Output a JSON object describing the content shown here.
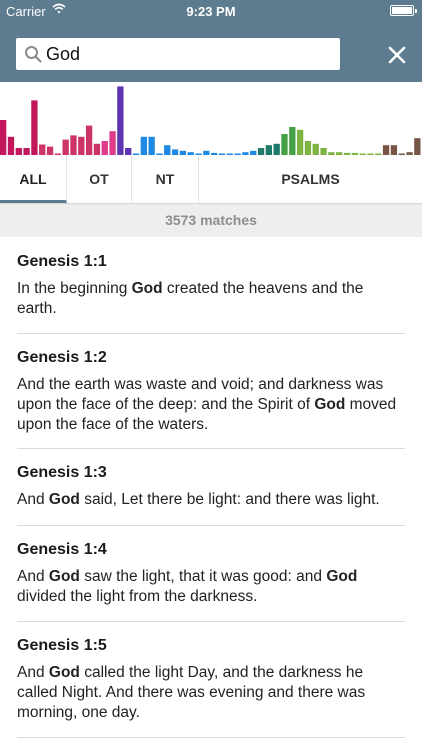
{
  "status": {
    "carrier": "Carrier",
    "time": "9:23 PM"
  },
  "search": {
    "query": "God",
    "placeholder": ""
  },
  "histogram": {
    "colors": {
      "law": "#c2185b",
      "history": "#cc3366",
      "poetry": "#e03b8a",
      "major_prophets": "#5e35b1",
      "minor_prophets": "#1e88e5",
      "gospels": "#1e7a6a",
      "acts": "#43a047",
      "epistles": "#7cb342",
      "revelation": "#795548"
    },
    "bars": [
      {
        "value": 0.5,
        "color": "law"
      },
      {
        "value": 0.26,
        "color": "law"
      },
      {
        "value": 0.1,
        "color": "law"
      },
      {
        "value": 0.1,
        "color": "law"
      },
      {
        "value": 0.78,
        "color": "law"
      },
      {
        "value": 0.15,
        "color": "history"
      },
      {
        "value": 0.12,
        "color": "history"
      },
      {
        "value": 0.02,
        "color": "history"
      },
      {
        "value": 0.22,
        "color": "history"
      },
      {
        "value": 0.28,
        "color": "history"
      },
      {
        "value": 0.26,
        "color": "history"
      },
      {
        "value": 0.42,
        "color": "history"
      },
      {
        "value": 0.16,
        "color": "history"
      },
      {
        "value": 0.2,
        "color": "poetry"
      },
      {
        "value": 0.34,
        "color": "poetry"
      },
      {
        "value": 0.98,
        "color": "major_prophets"
      },
      {
        "value": 0.1,
        "color": "major_prophets"
      },
      {
        "value": 0.02,
        "color": "minor_prophets"
      },
      {
        "value": 0.26,
        "color": "minor_prophets"
      },
      {
        "value": 0.26,
        "color": "minor_prophets"
      },
      {
        "value": 0.02,
        "color": "minor_prophets"
      },
      {
        "value": 0.14,
        "color": "minor_prophets"
      },
      {
        "value": 0.08,
        "color": "minor_prophets"
      },
      {
        "value": 0.06,
        "color": "minor_prophets"
      },
      {
        "value": 0.04,
        "color": "minor_prophets"
      },
      {
        "value": 0.02,
        "color": "minor_prophets"
      },
      {
        "value": 0.06,
        "color": "minor_prophets"
      },
      {
        "value": 0.03,
        "color": "minor_prophets"
      },
      {
        "value": 0.02,
        "color": "minor_prophets"
      },
      {
        "value": 0.02,
        "color": "minor_prophets"
      },
      {
        "value": 0.02,
        "color": "minor_prophets"
      },
      {
        "value": 0.04,
        "color": "minor_prophets"
      },
      {
        "value": 0.06,
        "color": "minor_prophets"
      },
      {
        "value": 0.1,
        "color": "gospels"
      },
      {
        "value": 0.14,
        "color": "gospels"
      },
      {
        "value": 0.16,
        "color": "gospels"
      },
      {
        "value": 0.3,
        "color": "acts"
      },
      {
        "value": 0.4,
        "color": "acts"
      },
      {
        "value": 0.36,
        "color": "epistles"
      },
      {
        "value": 0.2,
        "color": "epistles"
      },
      {
        "value": 0.16,
        "color": "epistles"
      },
      {
        "value": 0.1,
        "color": "epistles"
      },
      {
        "value": 0.04,
        "color": "epistles"
      },
      {
        "value": 0.04,
        "color": "epistles"
      },
      {
        "value": 0.03,
        "color": "epistles"
      },
      {
        "value": 0.03,
        "color": "epistles"
      },
      {
        "value": 0.02,
        "color": "epistles"
      },
      {
        "value": 0.02,
        "color": "epistles"
      },
      {
        "value": 0.02,
        "color": "epistles"
      },
      {
        "value": 0.14,
        "color": "revelation"
      },
      {
        "value": 0.14,
        "color": "revelation"
      },
      {
        "value": 0.02,
        "color": "revelation"
      },
      {
        "value": 0.04,
        "color": "revelation"
      },
      {
        "value": 0.24,
        "color": "revelation"
      }
    ]
  },
  "tabs": [
    {
      "label": "ALL",
      "active": true
    },
    {
      "label": "OT",
      "active": false
    },
    {
      "label": "NT",
      "active": false
    },
    {
      "label": "PSALMS",
      "active": false
    }
  ],
  "match_count": "3573 matches",
  "results": [
    {
      "ref": "Genesis 1:1",
      "text": [
        "In the beginning ",
        "God",
        " created the heavens and the earth."
      ]
    },
    {
      "ref": "Genesis 1:2",
      "text": [
        "And the earth was waste and void; and darkness was upon the face of the deep: and the Spirit of ",
        "God",
        " moved upon the face of the waters."
      ]
    },
    {
      "ref": "Genesis 1:3",
      "text": [
        "And ",
        "God",
        " said, Let there be light: and there was light."
      ]
    },
    {
      "ref": "Genesis 1:4",
      "text": [
        "And ",
        "God",
        " saw the light, that it was good: and ",
        "God",
        " divided the light from the darkness."
      ]
    },
    {
      "ref": "Genesis 1:5",
      "text": [
        "And ",
        "God",
        " called the light Day, and the darkness he called Night. And there was evening and there was morning, one day."
      ]
    }
  ]
}
